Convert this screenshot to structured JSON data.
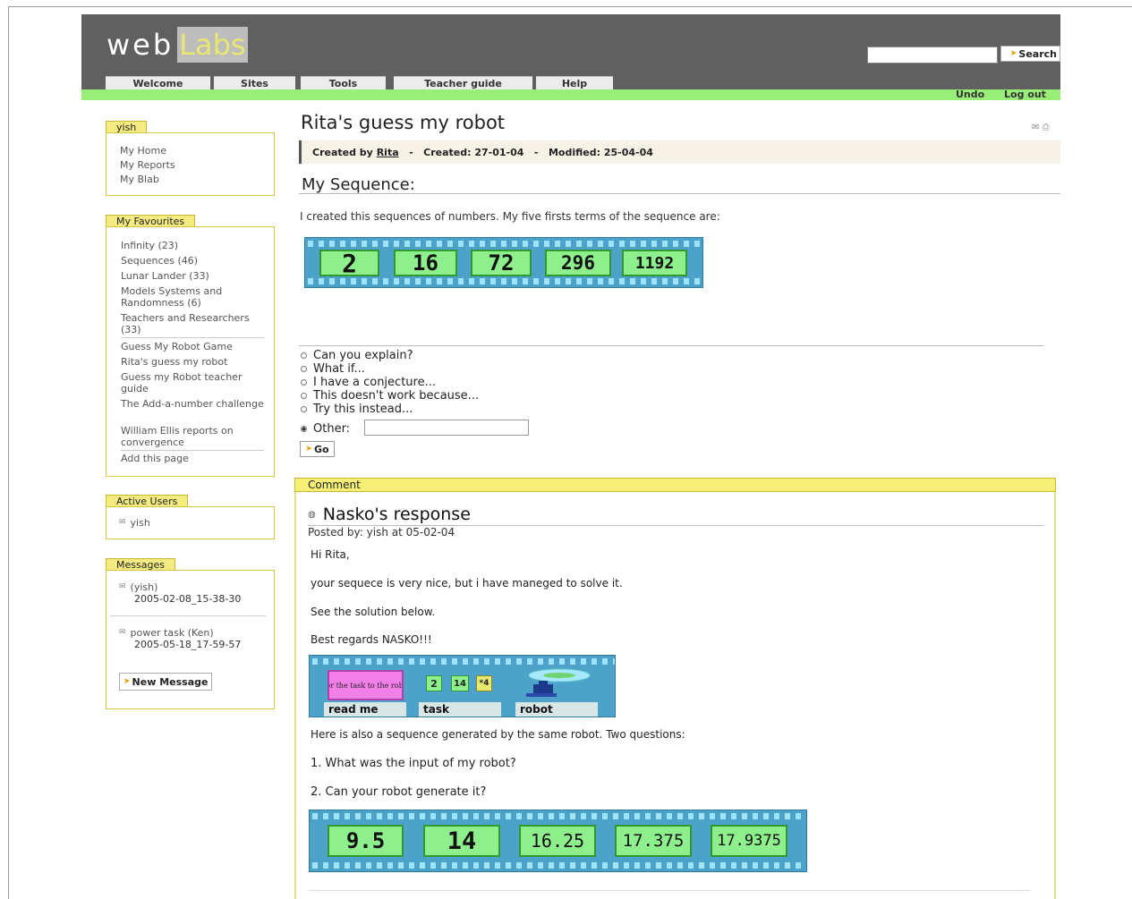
{
  "header": {
    "logo_web": "web",
    "logo_labs": "Labs",
    "search_value": "",
    "search_label": "Search",
    "tabs": [
      "Welcome",
      "Sites",
      "Tools",
      "Teacher guide",
      "Help"
    ],
    "undo_label": "Undo",
    "logout_label": "Log out"
  },
  "sidebar": {
    "user_box": {
      "title": "yish",
      "links": [
        "My Home",
        "My Reports",
        "My Blab"
      ]
    },
    "favourites": {
      "title": "My Favourites",
      "items": [
        "Infinity (23)",
        "Sequences (46)",
        "Lunar Lander (33)",
        "Models Systems and Randomness (6)",
        "Teachers and Researchers (33)",
        "Guess My Robot Game",
        "Rita's guess my robot",
        "Guess my Robot teacher guide",
        "The Add-a-number challenge",
        "William Ellis reports on convergence",
        "Add this page"
      ]
    },
    "active_users": {
      "title": "Active Users",
      "users": [
        "yish"
      ]
    },
    "messages": {
      "title": "Messages",
      "items": [
        {
          "from": "(yish)",
          "date": "2005-02-08_15-38-30"
        },
        {
          "from": "power task (Ken)",
          "date": "2005-05-18_17-59-57"
        }
      ],
      "new_message_label": "New Message"
    }
  },
  "main": {
    "title": "Rita's guess my robot",
    "created_by_label": "Created by",
    "author": "Rita",
    "created": "Created: 27-01-04",
    "modified": "Modified: 25-04-04",
    "section_heading": "My Sequence:",
    "intro_text": "I created this sequences of numbers. My five firsts terms of the sequence are:",
    "sequence": [
      "2",
      "16",
      "72",
      "296",
      "1192"
    ],
    "options": [
      {
        "label": "Can you explain?",
        "selected": false
      },
      {
        "label": "What if...",
        "selected": false
      },
      {
        "label": "I have a conjecture...",
        "selected": false
      },
      {
        "label": "This doesn't work because...",
        "selected": false
      },
      {
        "label": "Try this instead...",
        "selected": false
      },
      {
        "label": "Other:",
        "selected": true
      }
    ],
    "other_value": "",
    "go_label": "Go"
  },
  "comment": {
    "bar_label": "Comment",
    "response_title": "Nasko's response",
    "posted_by": "Posted by: yish at 05-02-04",
    "paragraphs": [
      "Hi Rita,",
      "your sequece is very nice, but i have maneged to solve it.",
      "See the solution below.",
      "Best regards NASKO!!!"
    ],
    "solution_boxes": {
      "readme_label": "read me",
      "task_label": "task",
      "robot_label": "robot",
      "readme_text": "Cor the task to the robot",
      "task_values": [
        "2",
        "14",
        "*4"
      ]
    },
    "followup_text": "Here is also a sequence generated by the same robot. Two questions:",
    "question1": "1. What was the input of my robot?",
    "question2": "2. Can your robot generate it?",
    "sequence2": [
      "9.5",
      "14",
      "16.25",
      "17.375",
      "17.9375"
    ]
  }
}
